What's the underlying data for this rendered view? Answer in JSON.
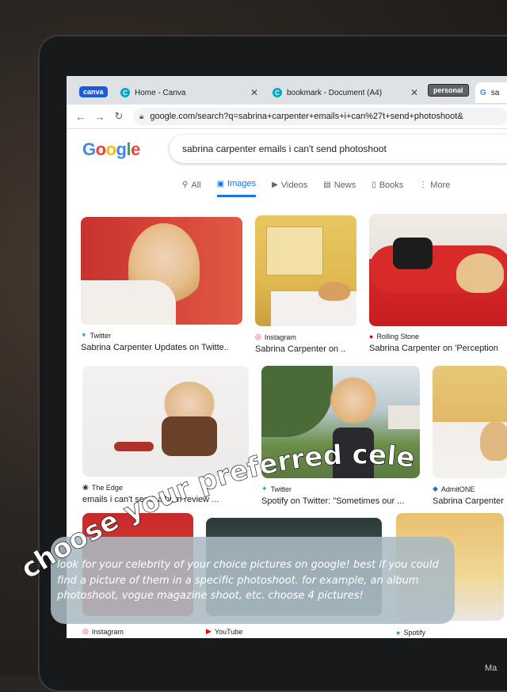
{
  "tabs": {
    "canva_chip": "canva",
    "home_title": "Home - Canva",
    "bookmark_title": "bookmark - Document (A4)",
    "personal_chip": "personal",
    "google_tab": "sa",
    "favicon_letter": "C",
    "google_favicon": "G"
  },
  "toolbar": {
    "url": "google.com/search?q=sabrina+carpenter+emails+i+can%27t+send+photoshoot&"
  },
  "google": {
    "logo_letters": [
      "G",
      "o",
      "o",
      "g",
      "l",
      "e"
    ],
    "logo_colors": [
      "#4285f4",
      "#ea4335",
      "#fbbc05",
      "#4285f4",
      "#34a853",
      "#ea4335"
    ],
    "query": "sabrina carpenter emails i can't send photoshoot",
    "tabs": [
      {
        "label": "All",
        "icon": "search-icon"
      },
      {
        "label": "Images",
        "icon": "image-icon"
      },
      {
        "label": "Videos",
        "icon": "play-icon"
      },
      {
        "label": "News",
        "icon": "news-icon"
      },
      {
        "label": "Books",
        "icon": "book-icon"
      },
      {
        "label": "More",
        "icon": "more-icon"
      }
    ]
  },
  "results": [
    {
      "source": "Twitter",
      "title": "Sabrina Carpenter Updates on Twitte..",
      "icon": "twitter-icon",
      "color": "#1d9bf0"
    },
    {
      "source": "Instagram",
      "title": "Sabrina Carpenter on ..",
      "icon": "instagram-icon",
      "color": "#e1306c"
    },
    {
      "source": "Rolling Stone",
      "title": "Sabrina Carpenter on 'Perception",
      "icon": "rolling-stone-icon",
      "color": "#d0021b"
    },
    {
      "source": "The Edge",
      "title": "emails i can't send' album review ...",
      "icon": "the-edge-icon",
      "color": "#333333"
    },
    {
      "source": "Twitter",
      "title": "Spotify on Twitter: \"Sometimes our ...",
      "icon": "twitter-icon",
      "color": "#1d9bf0"
    },
    {
      "source": "AdmitONE",
      "title": "Sabrina Carpenter",
      "icon": "admitone-icon",
      "color": "#2a6bd8"
    },
    {
      "source": "Instagram",
      "title": "",
      "icon": "instagram-icon",
      "color": "#e1306c"
    },
    {
      "source": "YouTube",
      "title": "",
      "icon": "youtube-icon",
      "color": "#ff0000"
    },
    {
      "source": "Spotify",
      "title": "",
      "icon": "spotify-icon",
      "color": "#1db954"
    }
  ],
  "overlay": {
    "heading": "choose your preferred celebrity",
    "body": "look for your celebrity of your choice pictures on google! best if you could find a picture of them in a specific photoshoot. for example, an album photoshoot, vogue magazine shoot, etc. choose 4 pictures!"
  },
  "device_label": "Ma"
}
